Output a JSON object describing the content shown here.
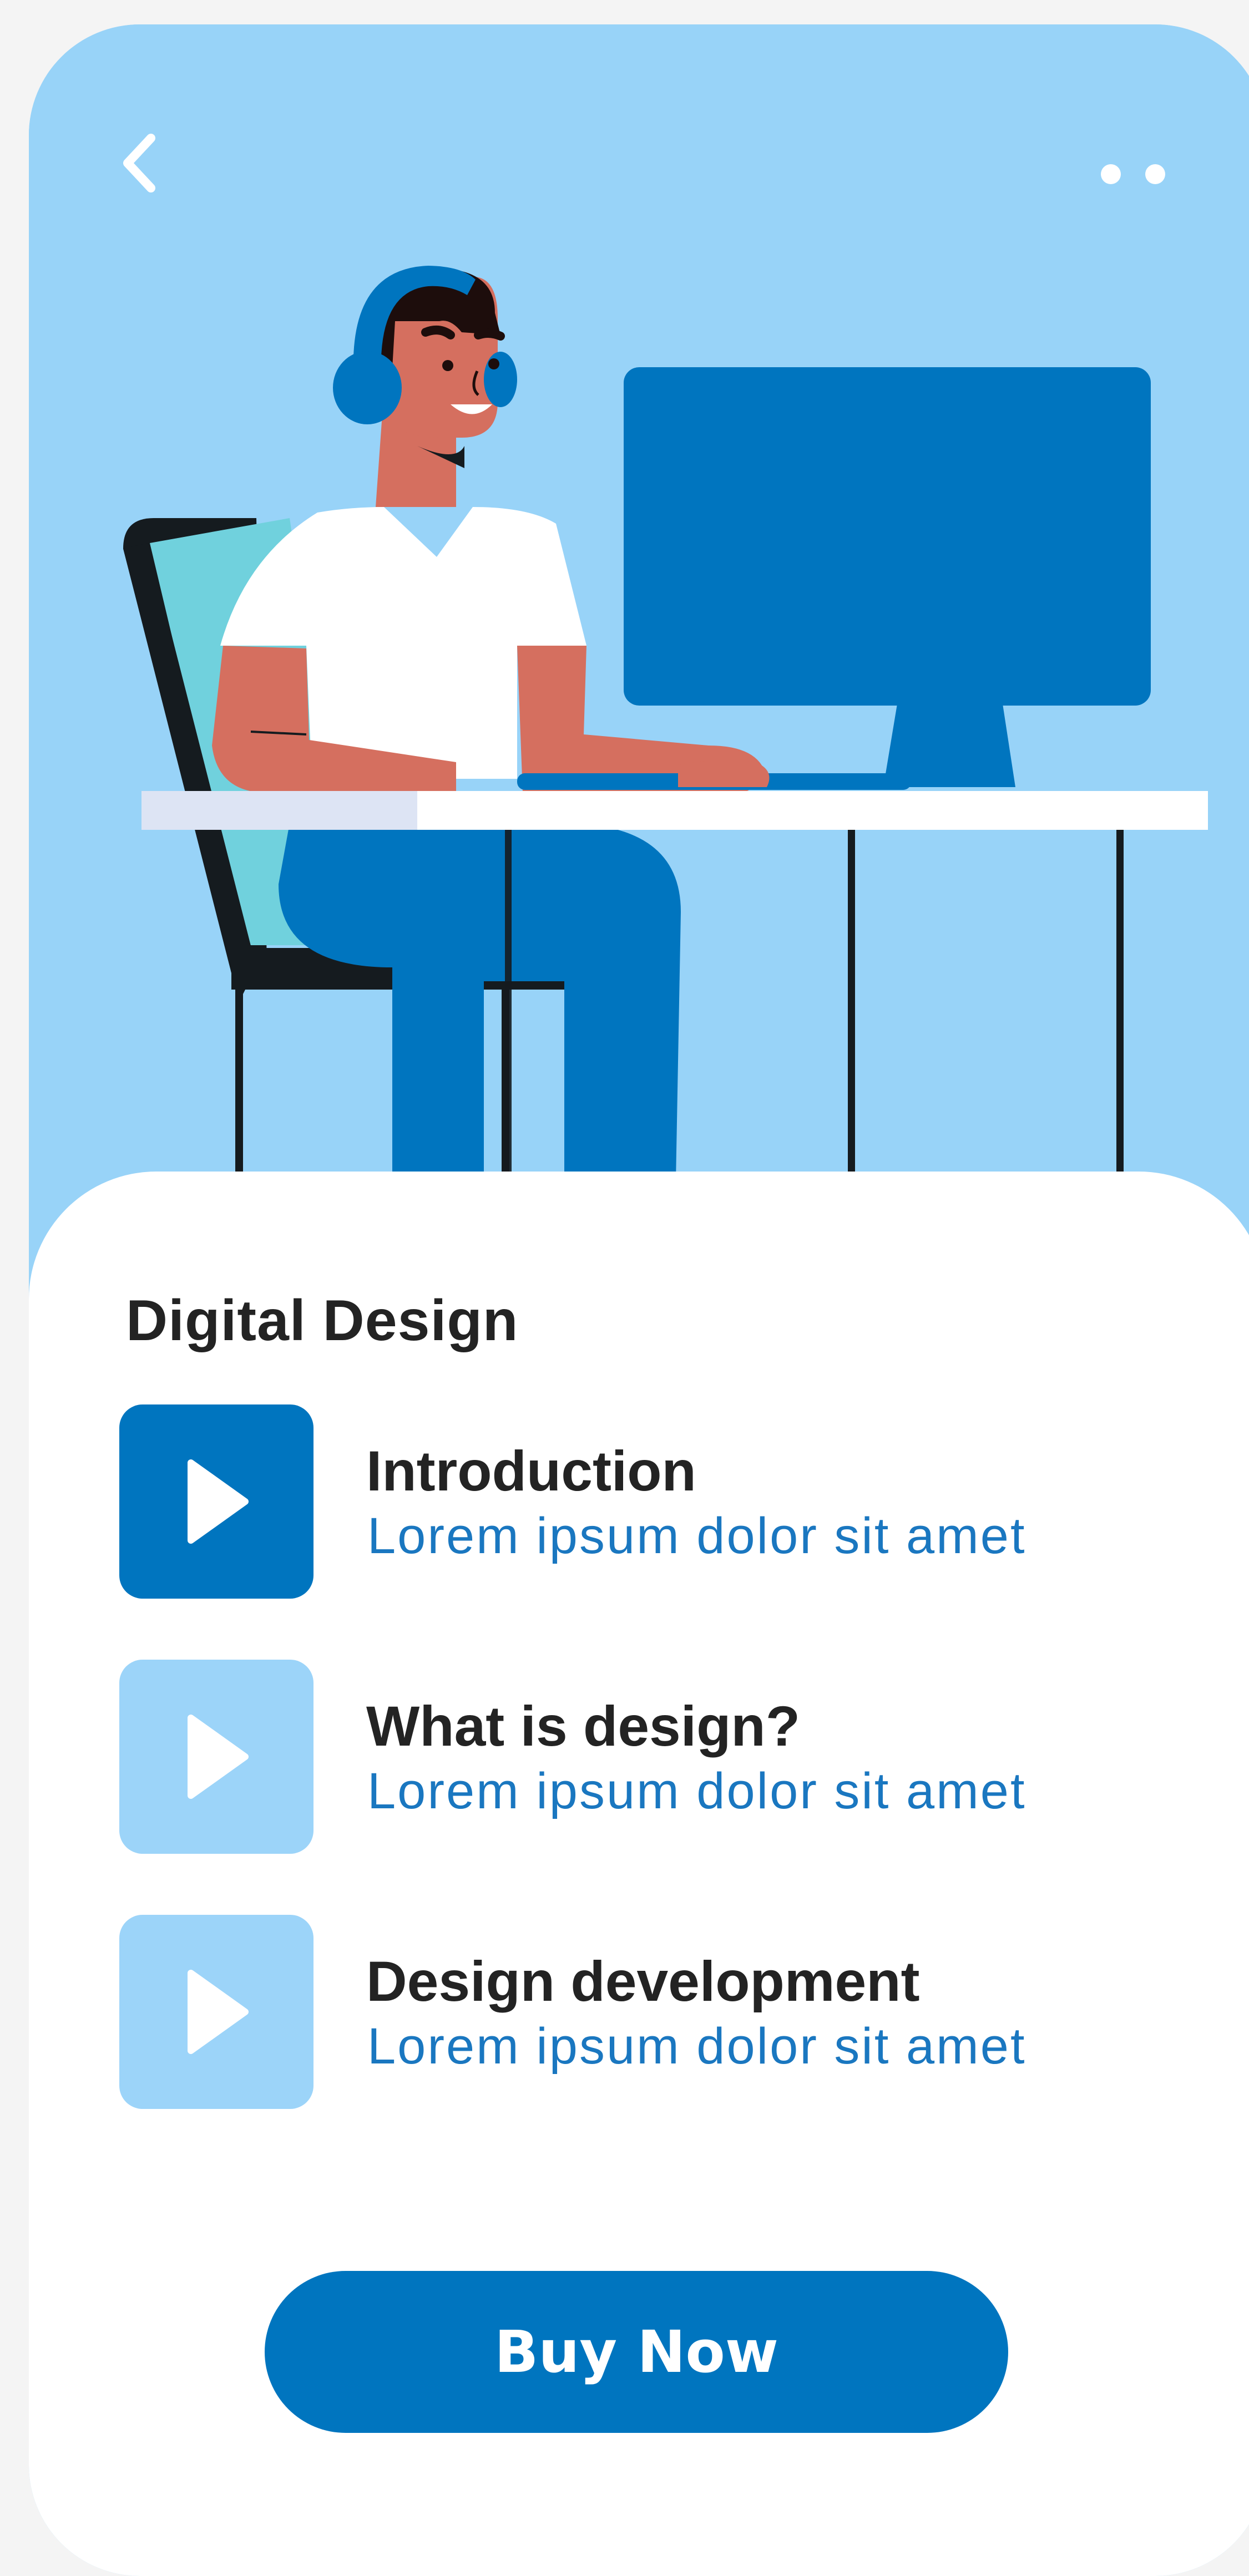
{
  "header": {
    "back_icon": "chevron-left-icon",
    "more_icon": "more-dots-icon"
  },
  "course": {
    "title": "Digital Design"
  },
  "lessons": [
    {
      "title": "Introduction",
      "subtitle": "Lorem ipsum dolor sit amet",
      "icon": "play-icon",
      "active": true
    },
    {
      "title": "What is design?",
      "subtitle": "Lorem ipsum dolor sit amet",
      "icon": "play-icon",
      "active": false
    },
    {
      "title": "Design development",
      "subtitle": "Lorem ipsum dolor sit amet",
      "icon": "play-icon",
      "active": false
    }
  ],
  "cta": {
    "label": "Buy Now"
  },
  "colors": {
    "hero_bg": "#98d3f8",
    "accent": "#0075bf",
    "thumb_inactive": "#9cd4f9",
    "title_text": "#232323",
    "subtitle_text": "#1a77c0",
    "sheet_bg": "#ffffff"
  }
}
